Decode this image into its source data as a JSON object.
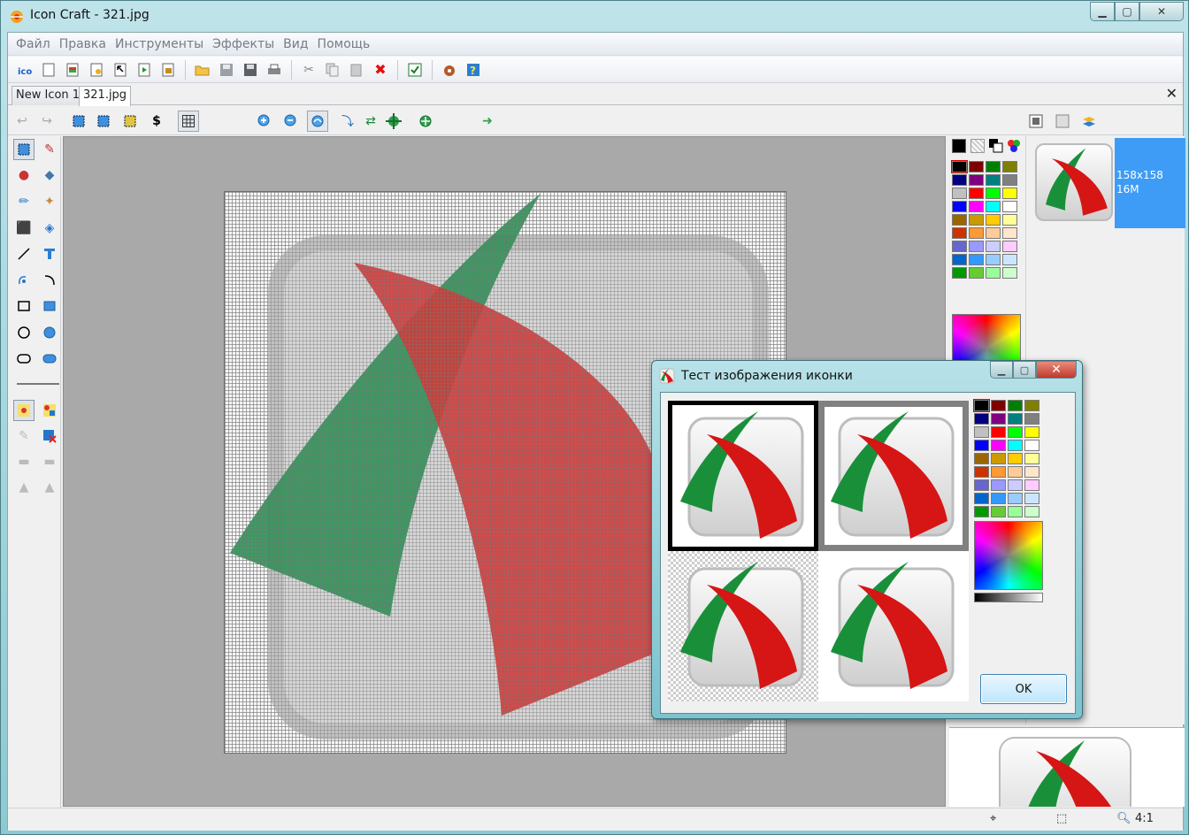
{
  "window": {
    "title": "Icon Craft - 321.jpg"
  },
  "menu": [
    "Файл",
    "Правка",
    "Инструменты",
    "Эффекты",
    "Вид",
    "Помощь"
  ],
  "tabs": [
    {
      "label": "New Icon 1",
      "active": false
    },
    {
      "label": "321.jpg",
      "active": true
    }
  ],
  "toolbar": {
    "file_icons": [
      "ico-icon",
      "new-icon",
      "new-from-image-icon",
      "new-from-file-icon",
      "extract-icon",
      "export-icon",
      "import-icon"
    ],
    "edit_icons": [
      "open-folder-icon",
      "save-icon",
      "save-all-icon",
      "print-icon",
      "cut-icon",
      "copy-icon",
      "paste-icon",
      "delete-icon",
      "check-icon",
      "resources-icon",
      "help-icon"
    ]
  },
  "preview": {
    "size_label": "158x158",
    "depth_label": "16M"
  },
  "status": {
    "zoom": "4:1"
  },
  "dialog": {
    "title": "Тест изображения иконки",
    "ok_label": "OK"
  },
  "palette": {
    "colors": [
      "#000000",
      "#800000",
      "#008000",
      "#808000",
      "#000080",
      "#800080",
      "#008080",
      "#808080",
      "#c0c0c0",
      "#ff0000",
      "#00ff00",
      "#ffff00",
      "#0000ff",
      "#ff00ff",
      "#00ffff",
      "#ffffff",
      "#996600",
      "#cc9900",
      "#ffcc00",
      "#ffff99",
      "#cc3300",
      "#ff9933",
      "#ffcc99",
      "#ffe5cc",
      "#6666cc",
      "#9999ff",
      "#ccccff",
      "#ffccff",
      "#0066cc",
      "#3399ff",
      "#99ccff",
      "#cce5ff",
      "#009900",
      "#66cc33",
      "#99ff99",
      "#ccffcc"
    ]
  },
  "colors": {
    "accent": "#3e9cf6",
    "canvas_bg": "#a9a9a9",
    "icon_green": "#1a8f3a",
    "icon_red": "#d61515"
  }
}
